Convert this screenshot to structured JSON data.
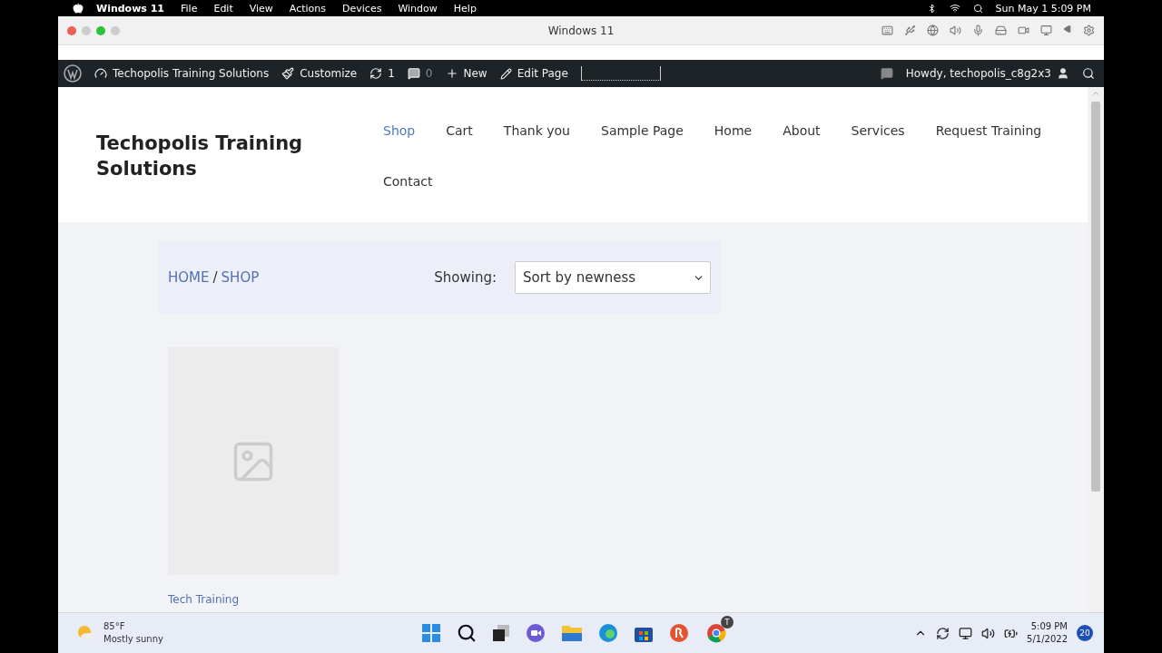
{
  "mac_menu": {
    "app": "Windows 11",
    "items": [
      "File",
      "Edit",
      "View",
      "Actions",
      "Devices",
      "Window",
      "Help"
    ],
    "clock": "Sun May 1  5:09 PM"
  },
  "vm_window": {
    "title": "Windows 11"
  },
  "admin_bar": {
    "site": "Techopolis Training Solutions",
    "customize": "Customize",
    "updates": "1",
    "comments": "0",
    "new": "New",
    "edit": "Edit Page",
    "howdy": "Howdy, techopolis_c8g2x3"
  },
  "site": {
    "title": "Techopolis Training Solutions",
    "nav": [
      {
        "label": "Shop",
        "selected": true
      },
      {
        "label": "Cart",
        "selected": false
      },
      {
        "label": "Thank you",
        "selected": false
      },
      {
        "label": "Sample Page",
        "selected": false
      },
      {
        "label": "Home",
        "selected": false
      },
      {
        "label": "About",
        "selected": false
      },
      {
        "label": "Services",
        "selected": false
      },
      {
        "label": "Request Training",
        "selected": false
      },
      {
        "label": "Contact",
        "selected": false
      }
    ]
  },
  "shop": {
    "breadcrumb": [
      "HOME",
      "SHOP"
    ],
    "separator": "/",
    "showing_label": "Showing:",
    "sort": "Sort by newness",
    "products": [
      {
        "name": "Tech Training"
      }
    ]
  },
  "taskbar": {
    "weather_temp": "85°F",
    "weather_text": "Mostly sunny",
    "chrome_badge": "T",
    "time": "5:09 PM",
    "date": "5/1/2022",
    "notifications": "20"
  }
}
